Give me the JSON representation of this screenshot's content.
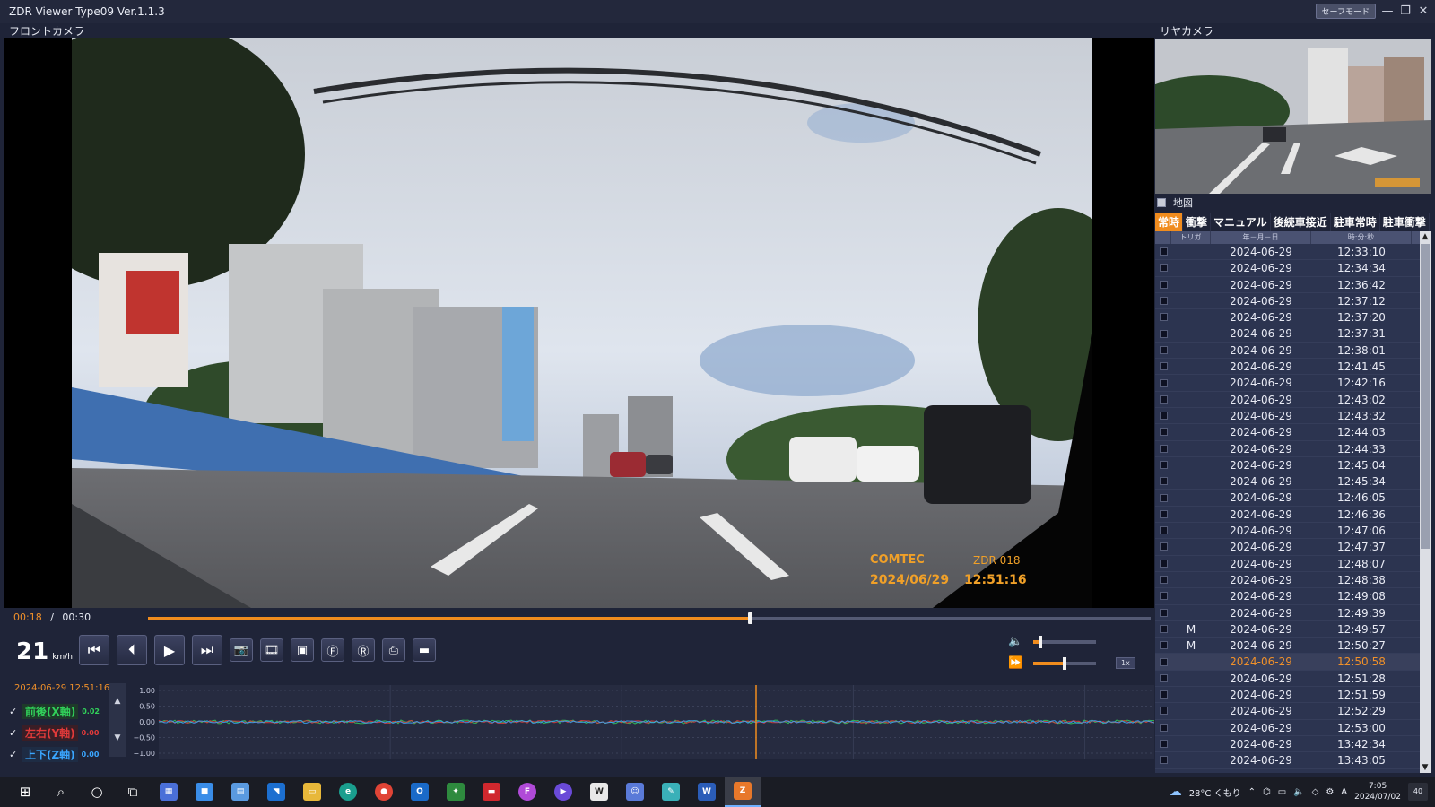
{
  "window": {
    "title": "ZDR Viewer Type09 Ver.1.1.3",
    "safe_mode_button": "セーフモード",
    "minimize": "—",
    "restore": "❐",
    "close": "✕"
  },
  "front_camera": {
    "label": "フロントカメラ",
    "overlay_brand": "COMTEC",
    "overlay_model": "ZDR 018",
    "overlay_date": "2024/06/29",
    "overlay_time": "12:51:16"
  },
  "rear_camera": {
    "label": "リヤカメラ"
  },
  "map_toggle": {
    "label": "地図"
  },
  "tabs": [
    {
      "label": "常時",
      "active": true
    },
    {
      "label": "衝撃",
      "active": false
    },
    {
      "label": "マニュアル",
      "active": false
    },
    {
      "label": "後続車接近",
      "active": false
    },
    {
      "label": "駐車常時",
      "active": false
    },
    {
      "label": "駐車衝撃",
      "active": false
    }
  ],
  "table": {
    "headers": [
      "",
      "トリガ",
      "年－月－日",
      "時:分:秒"
    ],
    "rows": [
      {
        "trigger": "",
        "date": "2024-06-29",
        "time": "12:33:10"
      },
      {
        "trigger": "",
        "date": "2024-06-29",
        "time": "12:34:34"
      },
      {
        "trigger": "",
        "date": "2024-06-29",
        "time": "12:36:42"
      },
      {
        "trigger": "",
        "date": "2024-06-29",
        "time": "12:37:12"
      },
      {
        "trigger": "",
        "date": "2024-06-29",
        "time": "12:37:20"
      },
      {
        "trigger": "",
        "date": "2024-06-29",
        "time": "12:37:31"
      },
      {
        "trigger": "",
        "date": "2024-06-29",
        "time": "12:38:01"
      },
      {
        "trigger": "",
        "date": "2024-06-29",
        "time": "12:41:45"
      },
      {
        "trigger": "",
        "date": "2024-06-29",
        "time": "12:42:16"
      },
      {
        "trigger": "",
        "date": "2024-06-29",
        "time": "12:43:02"
      },
      {
        "trigger": "",
        "date": "2024-06-29",
        "time": "12:43:32"
      },
      {
        "trigger": "",
        "date": "2024-06-29",
        "time": "12:44:03"
      },
      {
        "trigger": "",
        "date": "2024-06-29",
        "time": "12:44:33"
      },
      {
        "trigger": "",
        "date": "2024-06-29",
        "time": "12:45:04"
      },
      {
        "trigger": "",
        "date": "2024-06-29",
        "time": "12:45:34"
      },
      {
        "trigger": "",
        "date": "2024-06-29",
        "time": "12:46:05"
      },
      {
        "trigger": "",
        "date": "2024-06-29",
        "time": "12:46:36"
      },
      {
        "trigger": "",
        "date": "2024-06-29",
        "time": "12:47:06"
      },
      {
        "trigger": "",
        "date": "2024-06-29",
        "time": "12:47:37"
      },
      {
        "trigger": "",
        "date": "2024-06-29",
        "time": "12:48:07"
      },
      {
        "trigger": "",
        "date": "2024-06-29",
        "time": "12:48:38"
      },
      {
        "trigger": "",
        "date": "2024-06-29",
        "time": "12:49:08"
      },
      {
        "trigger": "",
        "date": "2024-06-29",
        "time": "12:49:39"
      },
      {
        "trigger": "M",
        "date": "2024-06-29",
        "time": "12:49:57"
      },
      {
        "trigger": "M",
        "date": "2024-06-29",
        "time": "12:50:27"
      },
      {
        "trigger": "",
        "date": "2024-06-29",
        "time": "12:50:58",
        "selected": true
      },
      {
        "trigger": "",
        "date": "2024-06-29",
        "time": "12:51:28"
      },
      {
        "trigger": "",
        "date": "2024-06-29",
        "time": "12:51:59"
      },
      {
        "trigger": "",
        "date": "2024-06-29",
        "time": "12:52:29"
      },
      {
        "trigger": "",
        "date": "2024-06-29",
        "time": "12:53:00"
      },
      {
        "trigger": "",
        "date": "2024-06-29",
        "time": "13:42:34"
      },
      {
        "trigger": "",
        "date": "2024-06-29",
        "time": "13:43:05"
      }
    ]
  },
  "playback": {
    "current": "00:18",
    "separator": "/",
    "total": "00:30",
    "progress": 0.6
  },
  "speed": {
    "value": "21",
    "unit": "km/h"
  },
  "controls": [
    {
      "name": "skip-back-button",
      "icon": "⏮"
    },
    {
      "name": "prev-frame-button",
      "icon": "⏴"
    },
    {
      "name": "play-button",
      "icon": "▶"
    },
    {
      "name": "skip-forward-button",
      "icon": "⏭"
    },
    {
      "name": "snapshot-button",
      "icon": "📷"
    },
    {
      "name": "record-clip-button",
      "icon": "🎞"
    },
    {
      "name": "window-button",
      "icon": "▣"
    },
    {
      "name": "front-view-button",
      "icon": "Ⓕ"
    },
    {
      "name": "rear-view-button",
      "icon": "Ⓡ"
    },
    {
      "name": "print-button",
      "icon": "⎙"
    },
    {
      "name": "folder-button",
      "icon": "▬"
    }
  ],
  "volume": {
    "level": 0.12
  },
  "playback_rate": {
    "label": "1x",
    "level": 0.5
  },
  "gsensor": {
    "timestamp": "2024-06-29 12:51:16",
    "axes": [
      {
        "name": "前後(X軸)",
        "value": "0.02",
        "color": "#31d15a"
      },
      {
        "name": "左右(Y軸)",
        "value": "0.00",
        "color": "#e23a3a"
      },
      {
        "name": "上下(Z軸)",
        "value": "0.00",
        "color": "#3aa6ff"
      }
    ],
    "y_ticks": [
      "1.00",
      "0.50",
      "0.00",
      "−0.50",
      "−1.00"
    ],
    "cursor_fraction": 0.6
  },
  "taskbar": {
    "weather": "28°C くもり",
    "time": "7:05",
    "date": "2024/07/02",
    "notifications": "40"
  }
}
